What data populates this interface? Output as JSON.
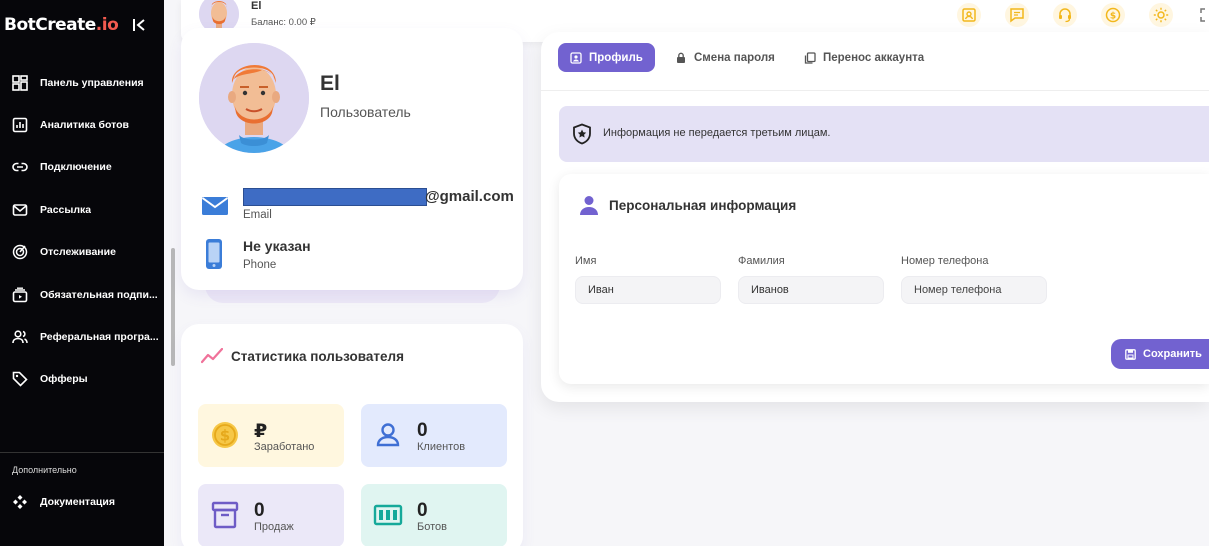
{
  "sidebar": {
    "logo_main": "BotCreate",
    "logo_ext": ".io",
    "items": [
      {
        "label": "Панель управления",
        "icon": "dashboard-icon"
      },
      {
        "label": "Аналитика ботов",
        "icon": "analytics-icon"
      },
      {
        "label": "Подключение",
        "icon": "link-icon"
      },
      {
        "label": "Рассылка",
        "icon": "mail-icon"
      },
      {
        "label": "Отслеживание",
        "icon": "tracking-icon"
      },
      {
        "label": "Обязательная подпи...",
        "icon": "subscription-icon"
      },
      {
        "label": "Реферальная програ...",
        "icon": "referral-icon"
      },
      {
        "label": "Офферы",
        "icon": "tag-icon"
      }
    ],
    "extra_title": "Дополнительно",
    "extra_items": [
      {
        "label": "Документация",
        "icon": "docs-icon"
      }
    ]
  },
  "header": {
    "user_name": "El",
    "balance": "Баланс: 0.00 ₽",
    "icons": [
      "contact-icon",
      "chat-icon",
      "support-icon",
      "dollar-icon",
      "sun-icon",
      "fullscreen-icon"
    ]
  },
  "profile": {
    "name": "El",
    "role": "Пользователь",
    "email_domain": "@gmail.com",
    "email_label": "Email",
    "phone_value": "Не указан",
    "phone_label": "Phone"
  },
  "stats": {
    "title": "Статистика пользователя",
    "items": [
      {
        "value": "₽",
        "label": "Заработано",
        "icon": "coin-icon"
      },
      {
        "value": "0",
        "label": "Клиентов",
        "icon": "user-icon"
      },
      {
        "value": "0",
        "label": "Продаж",
        "icon": "archive-icon"
      },
      {
        "value": "0",
        "label": "Ботов",
        "icon": "bots-icon"
      }
    ]
  },
  "tabs": [
    {
      "label": "Профиль",
      "active": true
    },
    {
      "label": "Смена пароля",
      "active": false
    },
    {
      "label": "Перенос аккаунта",
      "active": false
    }
  ],
  "notice": "Информация не передается третьим лицам.",
  "form": {
    "title": "Персональная информация",
    "fields": [
      {
        "label": "Имя",
        "value": "Иван",
        "placeholder": ""
      },
      {
        "label": "Фамилия",
        "value": "Иванов",
        "placeholder": ""
      },
      {
        "label": "Номер телефона",
        "value": "",
        "placeholder": "Номер телефона"
      }
    ],
    "save_label": "Сохранить"
  },
  "colors": {
    "accent": "#7262d0",
    "sidebar_bg": "#06060a",
    "logo_ext": "#f35a4f"
  }
}
